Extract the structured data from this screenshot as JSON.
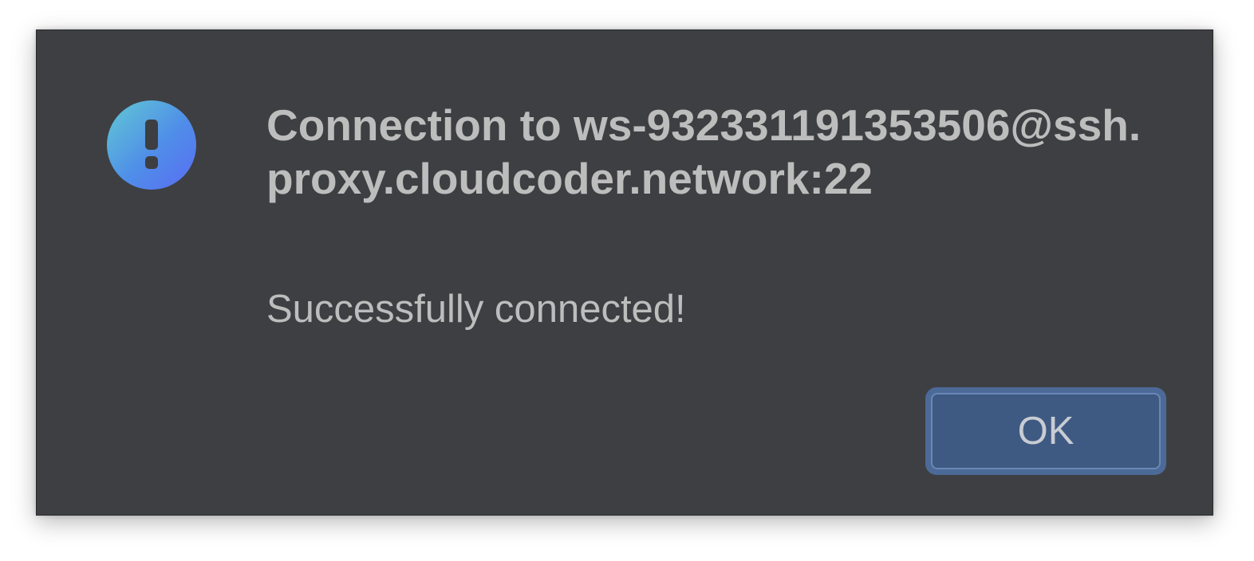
{
  "dialog": {
    "title": "Connection to ws-932331191353506@ssh.proxy.cloudcoder.network:22",
    "message": "Successfully connected!",
    "ok_label": "OK",
    "icon": "exclamation-icon"
  },
  "colors": {
    "dialog_background": "#3e3f42",
    "text": "#bdbdbd",
    "button_fill": "#3f5a82",
    "button_focus_ring": "#4c6a98",
    "icon_gradient_start": "#62c9d4",
    "icon_gradient_end": "#5a6cf3"
  }
}
